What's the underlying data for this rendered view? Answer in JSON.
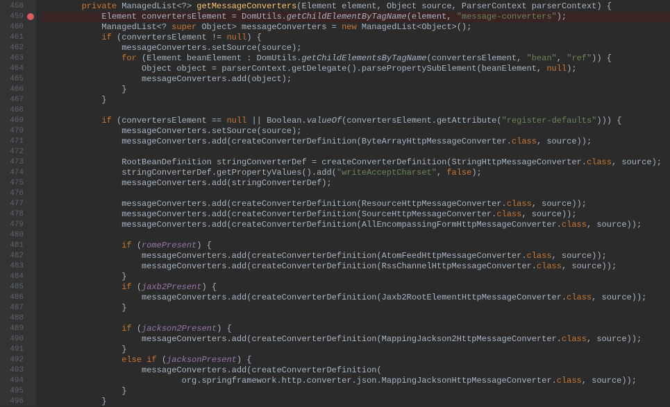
{
  "gutter": {
    "start": 458,
    "end": 496,
    "breakpointLine": 459
  },
  "code": {
    "458": [
      {
        "c": "kw",
        "t": "private"
      },
      {
        "c": "id",
        "t": " ManagedList<?> "
      },
      {
        "c": "mn",
        "t": "getMessageConverters"
      },
      {
        "c": "id",
        "t": "(Element element, Object source, ParserContext parserContext) {"
      }
    ],
    "459": [
      {
        "c": "id",
        "t": "    Element convertersElement = DomUtils."
      },
      {
        "c": "it",
        "t": "getChildElementByTagName"
      },
      {
        "c": "id",
        "t": "(element, "
      },
      {
        "c": "st",
        "t": "\"message-converters\""
      },
      {
        "c": "id",
        "t": ");"
      }
    ],
    "460": [
      {
        "c": "id",
        "t": "    ManagedList<? "
      },
      {
        "c": "kw",
        "t": "super"
      },
      {
        "c": "id",
        "t": " Object> messageConverters = "
      },
      {
        "c": "kw",
        "t": "new"
      },
      {
        "c": "id",
        "t": " ManagedList<Object>();"
      }
    ],
    "461": [
      {
        "c": "kw",
        "t": "    if"
      },
      {
        "c": "id",
        "t": " (convertersElement != "
      },
      {
        "c": "kw",
        "t": "null"
      },
      {
        "c": "id",
        "t": ") {"
      }
    ],
    "462": [
      {
        "c": "id",
        "t": "        messageConverters.setSource(source);"
      }
    ],
    "463": [
      {
        "c": "kw",
        "t": "        for"
      },
      {
        "c": "id",
        "t": " (Element beanElement : DomUtils."
      },
      {
        "c": "it",
        "t": "getChildElementsByTagName"
      },
      {
        "c": "id",
        "t": "(convertersElement, "
      },
      {
        "c": "st",
        "t": "\"bean\""
      },
      {
        "c": "id",
        "t": ", "
      },
      {
        "c": "st",
        "t": "\"ref\""
      },
      {
        "c": "id",
        "t": ")) {"
      }
    ],
    "464": [
      {
        "c": "id",
        "t": "            Object object = parserContext.getDelegate().parsePropertySubElement(beanElement, "
      },
      {
        "c": "kw",
        "t": "null"
      },
      {
        "c": "id",
        "t": ");"
      }
    ],
    "465": [
      {
        "c": "id",
        "t": "            messageConverters.add(object);"
      }
    ],
    "466": [
      {
        "c": "id",
        "t": "        }"
      }
    ],
    "467": [
      {
        "c": "id",
        "t": "    }"
      }
    ],
    "468": [
      {
        "c": "id",
        "t": ""
      }
    ],
    "469": [
      {
        "c": "kw",
        "t": "    if"
      },
      {
        "c": "id",
        "t": " (convertersElement == "
      },
      {
        "c": "kw",
        "t": "null"
      },
      {
        "c": "id",
        "t": " || Boolean."
      },
      {
        "c": "it",
        "t": "valueOf"
      },
      {
        "c": "id",
        "t": "(convertersElement.getAttribute("
      },
      {
        "c": "st",
        "t": "\"register-defaults\""
      },
      {
        "c": "id",
        "t": "))) {"
      }
    ],
    "470": [
      {
        "c": "id",
        "t": "        messageConverters.setSource(source);"
      }
    ],
    "471": [
      {
        "c": "id",
        "t": "        messageConverters.add(createConverterDefinition(ByteArrayHttpMessageConverter."
      },
      {
        "c": "kw",
        "t": "class"
      },
      {
        "c": "id",
        "t": ", source));"
      }
    ],
    "472": [
      {
        "c": "id",
        "t": ""
      }
    ],
    "473": [
      {
        "c": "id",
        "t": "        RootBeanDefinition stringConverterDef = createConverterDefinition(StringHttpMessageConverter."
      },
      {
        "c": "kw",
        "t": "class"
      },
      {
        "c": "id",
        "t": ", source);"
      }
    ],
    "474": [
      {
        "c": "id",
        "t": "        stringConverterDef.getPropertyValues().add("
      },
      {
        "c": "st",
        "t": "\"writeAcceptCharset\""
      },
      {
        "c": "id",
        "t": ", "
      },
      {
        "c": "kw",
        "t": "false"
      },
      {
        "c": "id",
        "t": ");"
      }
    ],
    "475": [
      {
        "c": "id",
        "t": "        messageConverters.add(stringConverterDef);"
      }
    ],
    "476": [
      {
        "c": "id",
        "t": ""
      }
    ],
    "477": [
      {
        "c": "id",
        "t": "        messageConverters.add(createConverterDefinition(ResourceHttpMessageConverter."
      },
      {
        "c": "kw",
        "t": "class"
      },
      {
        "c": "id",
        "t": ", source));"
      }
    ],
    "478": [
      {
        "c": "id",
        "t": "        messageConverters.add(createConverterDefinition(SourceHttpMessageConverter."
      },
      {
        "c": "kw",
        "t": "class"
      },
      {
        "c": "id",
        "t": ", source));"
      }
    ],
    "479": [
      {
        "c": "id",
        "t": "        messageConverters.add(createConverterDefinition(AllEncompassingFormHttpMessageConverter."
      },
      {
        "c": "kw",
        "t": "class"
      },
      {
        "c": "id",
        "t": ", source));"
      }
    ],
    "480": [
      {
        "c": "id",
        "t": ""
      }
    ],
    "481": [
      {
        "c": "kw",
        "t": "        if"
      },
      {
        "c": "id",
        "t": " ("
      },
      {
        "c": "fld",
        "t": "romePresent"
      },
      {
        "c": "id",
        "t": ") {"
      }
    ],
    "482": [
      {
        "c": "id",
        "t": "            messageConverters.add(createConverterDefinition(AtomFeedHttpMessageConverter."
      },
      {
        "c": "kw",
        "t": "class"
      },
      {
        "c": "id",
        "t": ", source));"
      }
    ],
    "483": [
      {
        "c": "id",
        "t": "            messageConverters.add(createConverterDefinition(RssChannelHttpMessageConverter."
      },
      {
        "c": "kw",
        "t": "class"
      },
      {
        "c": "id",
        "t": ", source));"
      }
    ],
    "484": [
      {
        "c": "id",
        "t": "        }"
      }
    ],
    "485": [
      {
        "c": "kw",
        "t": "        if"
      },
      {
        "c": "id",
        "t": " ("
      },
      {
        "c": "fld",
        "t": "jaxb2Present"
      },
      {
        "c": "id",
        "t": ") {"
      }
    ],
    "486": [
      {
        "c": "id",
        "t": "            messageConverters.add(createConverterDefinition(Jaxb2RootElementHttpMessageConverter."
      },
      {
        "c": "kw",
        "t": "class"
      },
      {
        "c": "id",
        "t": ", source));"
      }
    ],
    "487": [
      {
        "c": "id",
        "t": "        }"
      }
    ],
    "488": [
      {
        "c": "id",
        "t": ""
      }
    ],
    "489": [
      {
        "c": "kw",
        "t": "        if"
      },
      {
        "c": "id",
        "t": " ("
      },
      {
        "c": "fld",
        "t": "jackson2Present"
      },
      {
        "c": "id",
        "t": ") {"
      }
    ],
    "490": [
      {
        "c": "id",
        "t": "            messageConverters.add(createConverterDefinition(MappingJackson2HttpMessageConverter."
      },
      {
        "c": "kw",
        "t": "class"
      },
      {
        "c": "id",
        "t": ", source));"
      }
    ],
    "491": [
      {
        "c": "id",
        "t": "        }"
      }
    ],
    "492": [
      {
        "c": "kw",
        "t": "        else if"
      },
      {
        "c": "id",
        "t": " ("
      },
      {
        "c": "fld",
        "t": "jacksonPresent"
      },
      {
        "c": "id",
        "t": ") {"
      }
    ],
    "493": [
      {
        "c": "id",
        "t": "            messageConverters.add(createConverterDefinition("
      }
    ],
    "494": [
      {
        "c": "id",
        "t": "                    org.springframework.http.converter.json.MappingJacksonHttpMessageConverter."
      },
      {
        "c": "kw",
        "t": "class"
      },
      {
        "c": "id",
        "t": ", source));"
      }
    ],
    "495": [
      {
        "c": "id",
        "t": "        }"
      }
    ],
    "496": [
      {
        "c": "id",
        "t": "    }"
      }
    ]
  },
  "indentPrefix": "        "
}
